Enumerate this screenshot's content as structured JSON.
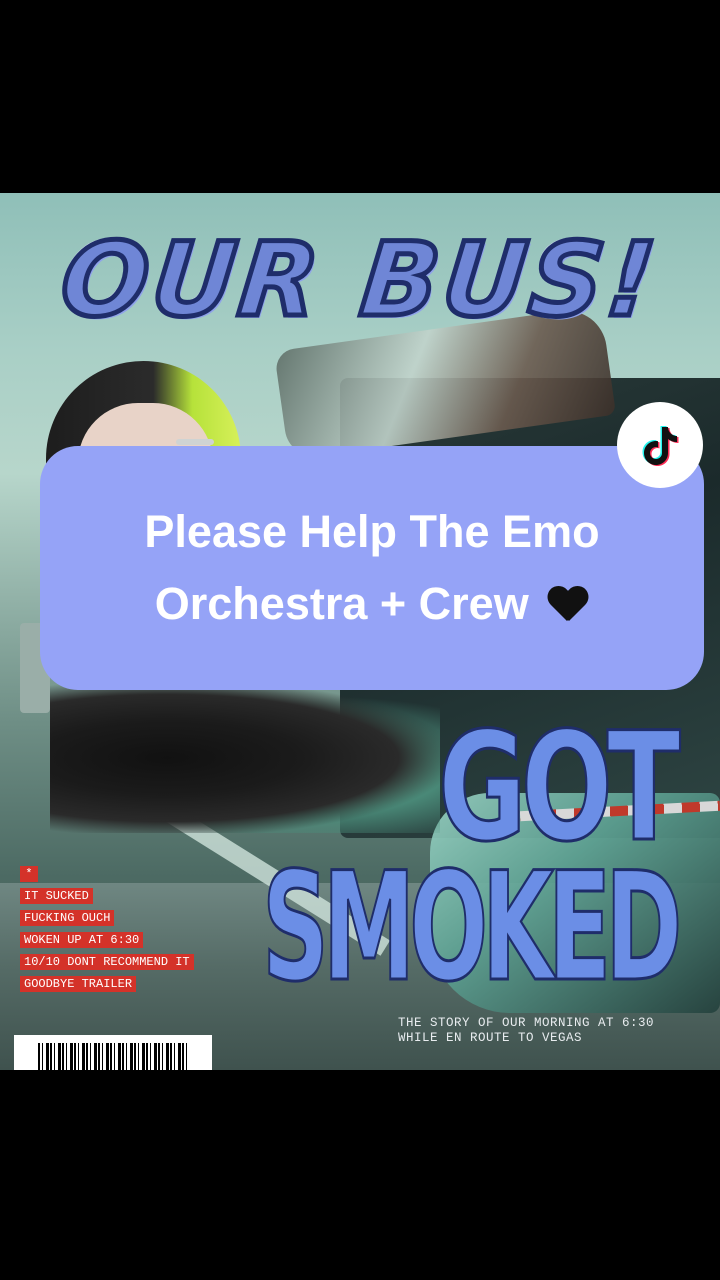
{
  "poster": {
    "headline": "OUR BUS!",
    "got": "GOT",
    "smoked": "SMOKED",
    "story": "THE STORY OF OUR MORNING AT 6:30 WHILE EN ROUTE TO VEGAS",
    "tags": [
      "*",
      "IT SUCKED",
      "FUCKING OUCH",
      "WOKEN UP AT 6:30",
      "10/10 DONT RECOMMEND IT",
      "GOODBYE TRAILER"
    ]
  },
  "caption": {
    "line1": "Please Help The Emo",
    "line2": "Orchestra + Crew"
  },
  "colors": {
    "caption_bg": "#95a3f7",
    "headline": "#6f86d6",
    "tag_red": "#d43229"
  },
  "icons": {
    "heart": "black-heart-icon",
    "brand": "tiktok-icon"
  }
}
